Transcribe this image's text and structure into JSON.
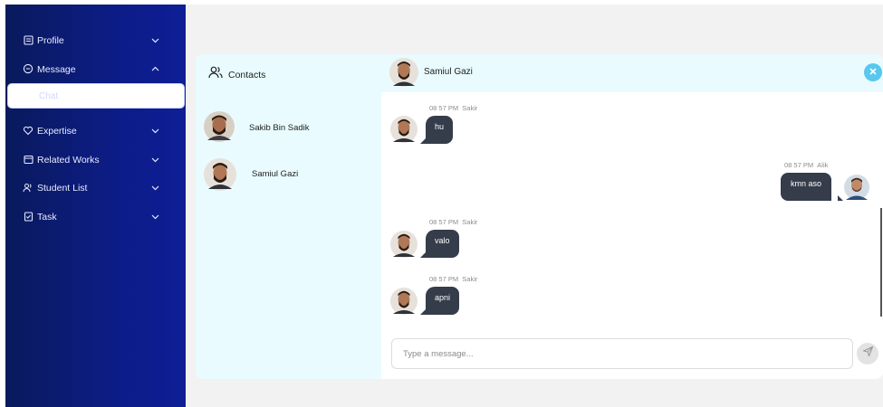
{
  "sidebar": {
    "items": [
      {
        "label": "Profile",
        "icon": "profile-icon",
        "chevron": "down"
      },
      {
        "label": "Message",
        "icon": "message-icon",
        "chevron": "up"
      },
      {
        "label": "Expertise",
        "icon": "heart-icon",
        "chevron": "down"
      },
      {
        "label": "Related Works",
        "icon": "works-icon",
        "chevron": "down"
      },
      {
        "label": "Student List",
        "icon": "users-icon",
        "chevron": "down"
      },
      {
        "label": "Task",
        "icon": "task-icon",
        "chevron": "down"
      }
    ],
    "submenu_item": "Chat"
  },
  "contacts": {
    "title": "Contacts",
    "list": [
      {
        "name": "Sakib Bin Sadik"
      },
      {
        "name": "Samiul Gazi"
      }
    ]
  },
  "chat": {
    "header_name": "Samiul Gazi",
    "messages": [
      {
        "time": "08 57 PM",
        "sender": "Sakir",
        "text": "hu",
        "direction": "in"
      },
      {
        "time": "08 57 PM",
        "sender": "Alik",
        "text": "kmn aso",
        "direction": "out"
      },
      {
        "time": "08 57 PM",
        "sender": "Sakir",
        "text": "valo",
        "direction": "in"
      },
      {
        "time": "08 57 PM",
        "sender": "Sakir",
        "text": "apni",
        "direction": "in"
      }
    ],
    "input_placeholder": "Type a message..."
  },
  "colors": {
    "sidebar": "#0c1c86",
    "panel": "#e9fbff",
    "bubble": "#353c4a",
    "close": "#59c7ee"
  }
}
